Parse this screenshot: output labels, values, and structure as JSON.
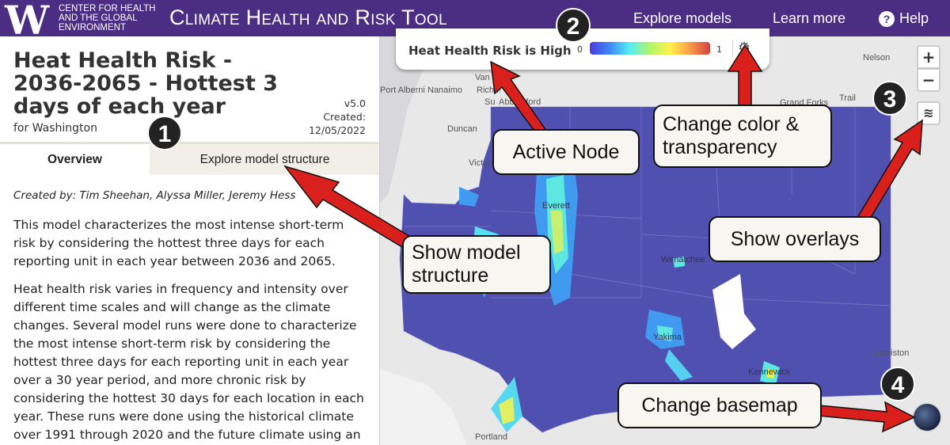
{
  "header": {
    "logo_letter": "W",
    "org": "CENTER FOR HEALTH AND THE GLOBAL ENVIRONMENT",
    "app_title": "Climate Health and Risk Tool",
    "nav": [
      "Explore models",
      "Learn more",
      "Help"
    ],
    "brand_color": "#4b2e83"
  },
  "model": {
    "title": "Heat Health Risk - 2036-2065 - Hottest 3 days of each year",
    "region": "for Washington",
    "version": "v5.0",
    "created_label": "Created:",
    "created_date": "12/05/2022",
    "tabs": [
      {
        "label": "Overview",
        "active": true
      },
      {
        "label": "Explore model structure",
        "active": false
      }
    ],
    "authors": "Created by: Tim Sheehan, Alyssa Miller, Jeremy Hess",
    "paragraphs": [
      "This model characterizes the most intense short-term risk by considering the hottest three days for each reporting unit in each year between 2036 and 2065.",
      "Heat health risk varies in frequency and intensity over different time scales and will change as the climate changes. Several model runs were done to characterize the most intense short-term risk by considering the hottest three days for each reporting unit in each year over a 30 year period, and more chronic risk by considering the hottest 30 days for each location in each year. These runs were done using the historical climate over 1991 through 2020 and the future climate using an"
    ]
  },
  "legend": {
    "active_node": "Heat Health Risk is High",
    "min": "0",
    "max": "1",
    "icon": "gear-icon"
  },
  "map": {
    "labels": [
      "Port Alberni",
      "Nanaimo",
      "Vancouver",
      "Richmond",
      "Surrey",
      "Abbotsford",
      "Duncan",
      "Victoria",
      "Nelson",
      "Trail",
      "Grand Forks",
      "Everett",
      "Wenatchee",
      "Yakima",
      "Kennewick",
      "Lewiston",
      "Portland"
    ],
    "zoom_in": "+",
    "zoom_out": "−"
  },
  "annotations": {
    "badges": [
      "1",
      "2",
      "3",
      "4"
    ],
    "callouts": [
      "Show model structure",
      "Active Node",
      "Change color & transparency",
      "Show overlays",
      "Change basemap"
    ],
    "arrow_color": "#d9201c"
  }
}
